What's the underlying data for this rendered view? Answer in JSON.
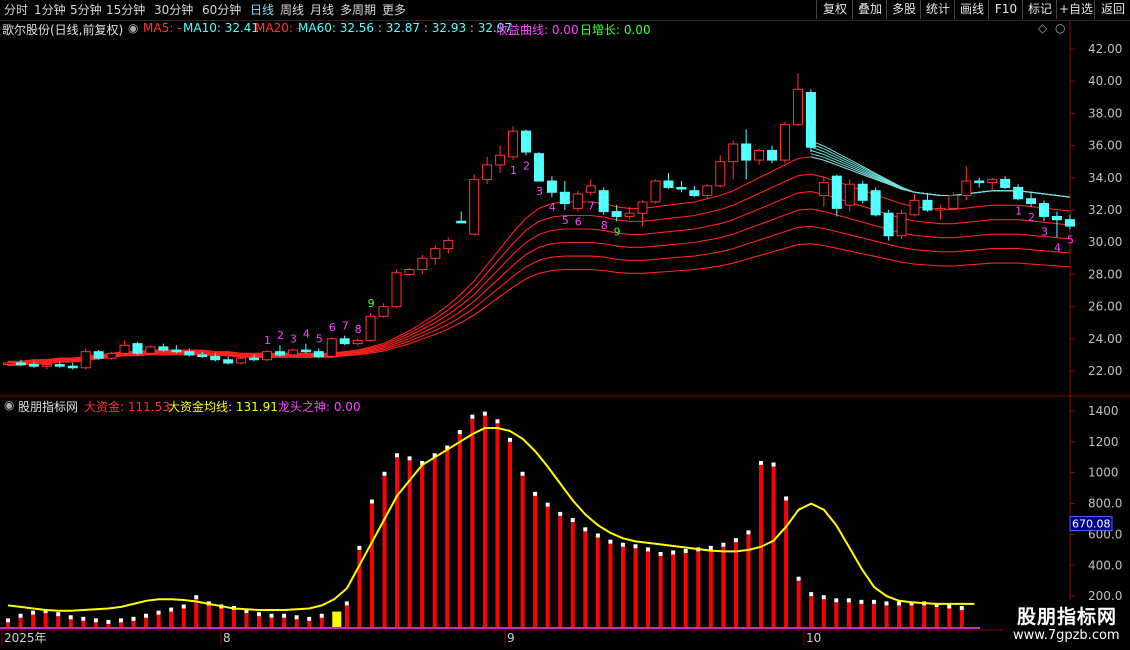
{
  "toolbar": {
    "periods": [
      "分时",
      "1分钟",
      "5分钟",
      "15分钟",
      "30分钟",
      "60分钟",
      "日线",
      "周线",
      "月线",
      "多周期",
      "更多"
    ],
    "active_period": "日线",
    "buttons": [
      "复权",
      "叠加",
      "多股",
      "统计",
      "画线",
      "F10",
      "标记",
      "+自选",
      "返回"
    ]
  },
  "upper_header": {
    "stock": "歌尔股份(日线,前复权)",
    "ma5": "MA5: -",
    "ma10": "MA10: 32.41",
    "ma20": "MA20: -",
    "ma60": "MA60: 32.56 : 32.87 : 32.93 : 32.97",
    "income": "收益曲线: 0.00",
    "daily": "日增长: 0.00"
  },
  "lower_header": {
    "name": "股朋指标网",
    "big_money": "大资金: 111.53",
    "big_money_avg": "大资金均线: 131.91",
    "dragon": "龙头之神: 0.00"
  },
  "upper_axis": [
    "42.00",
    "40.00",
    "38.00",
    "36.00",
    "34.00",
    "32.00",
    "30.00",
    "28.00",
    "26.00",
    "24.00",
    "22.00"
  ],
  "lower_axis": [
    "1400",
    "1200",
    "1000",
    "800.0",
    "600.0",
    "400.0",
    "200.0"
  ],
  "current_value_tag": "670.08",
  "date_labels": [
    "2025年",
    "8",
    "9",
    "10"
  ],
  "seq_labels": {
    "run1": [
      "1",
      "2",
      "3",
      "4",
      "5",
      "6",
      "7",
      "8",
      "9"
    ],
    "run2": [
      "1",
      "2",
      "3",
      "4",
      "5",
      "6",
      "7",
      "8",
      "9"
    ],
    "run3": [
      "1",
      "2",
      "3",
      "4",
      "5"
    ]
  },
  "colors": {
    "up": "#ff3232",
    "down": "#54ffff",
    "ma_band": "#ff2020",
    "ma_band_down": "#6fe0e0",
    "avg_line": "#ffff00",
    "bar": "#ff0000",
    "highlight_bar": "#ffff00",
    "seq_pink": "#ff40ff",
    "seq_green": "#40ff40",
    "axis": "#8b0000"
  },
  "watermark": {
    "title": "股朋指标网",
    "url": "www.7gpzb.com"
  },
  "icons": [
    "collapse-circle-icon",
    "diamond-icon",
    "caret-icon"
  ],
  "chart_data": [
    {
      "type": "candlestick",
      "title": "歌尔股份(日线,前复权)",
      "ylim": [
        21.0,
        43.0
      ],
      "ohlc": [
        [
          22.4,
          22.6,
          22.3,
          22.5
        ],
        [
          22.5,
          22.7,
          22.3,
          22.4
        ],
        [
          22.4,
          22.6,
          22.2,
          22.3
        ],
        [
          22.3,
          22.5,
          22.1,
          22.4
        ],
        [
          22.4,
          22.6,
          22.2,
          22.3
        ],
        [
          22.3,
          22.5,
          22.1,
          22.2
        ],
        [
          22.2,
          23.4,
          22.1,
          23.2
        ],
        [
          23.2,
          23.3,
          22.7,
          22.8
        ],
        [
          22.8,
          23.2,
          22.7,
          23.1
        ],
        [
          23.1,
          23.9,
          23.0,
          23.6
        ],
        [
          23.7,
          23.8,
          23.0,
          23.1
        ],
        [
          23.1,
          23.6,
          23.0,
          23.5
        ],
        [
          23.5,
          23.7,
          23.2,
          23.3
        ],
        [
          23.3,
          23.6,
          23.1,
          23.2
        ],
        [
          23.2,
          23.4,
          22.9,
          23.0
        ],
        [
          23.0,
          23.2,
          22.8,
          22.9
        ],
        [
          22.9,
          23.1,
          22.6,
          22.7
        ],
        [
          22.7,
          22.9,
          22.4,
          22.5
        ],
        [
          22.5,
          22.9,
          22.4,
          22.8
        ],
        [
          22.8,
          23.0,
          22.6,
          22.7
        ],
        [
          22.7,
          23.3,
          22.6,
          23.2
        ],
        [
          23.2,
          23.6,
          22.9,
          23.0
        ],
        [
          23.0,
          23.4,
          22.9,
          23.3
        ],
        [
          23.3,
          23.7,
          23.1,
          23.2
        ],
        [
          23.2,
          23.4,
          22.8,
          22.9
        ],
        [
          22.9,
          24.1,
          22.8,
          24.0
        ],
        [
          24.0,
          24.2,
          23.6,
          23.7
        ],
        [
          23.7,
          24.0,
          23.6,
          23.9
        ],
        [
          23.9,
          25.6,
          23.8,
          25.4
        ],
        [
          25.4,
          26.2,
          25.3,
          26.0
        ],
        [
          26.0,
          28.3,
          25.9,
          28.1
        ],
        [
          28.0,
          28.4,
          27.9,
          28.3
        ],
        [
          28.3,
          29.2,
          28.0,
          29.0
        ],
        [
          29.0,
          29.8,
          28.6,
          29.6
        ],
        [
          29.6,
          30.3,
          29.3,
          30.1
        ],
        [
          31.3,
          31.9,
          31.2,
          31.2
        ],
        [
          30.5,
          34.2,
          30.4,
          33.9
        ],
        [
          33.9,
          35.3,
          33.6,
          34.8
        ],
        [
          34.8,
          36.0,
          34.3,
          35.4
        ],
        [
          35.3,
          37.2,
          35.1,
          36.9
        ],
        [
          36.9,
          37.0,
          35.4,
          35.6
        ],
        [
          35.5,
          35.6,
          33.8,
          33.8
        ],
        [
          33.8,
          34.1,
          32.8,
          33.1
        ],
        [
          33.1,
          33.8,
          32.0,
          32.4
        ],
        [
          32.1,
          33.2,
          31.9,
          33.0
        ],
        [
          33.1,
          33.9,
          32.9,
          33.5
        ],
        [
          33.2,
          33.4,
          31.7,
          31.9
        ],
        [
          31.9,
          32.3,
          31.3,
          31.6
        ],
        [
          31.6,
          32.2,
          31.4,
          31.8
        ],
        [
          31.8,
          32.6,
          31.0,
          32.5
        ],
        [
          32.5,
          33.9,
          32.4,
          33.8
        ],
        [
          33.8,
          34.3,
          33.3,
          33.4
        ],
        [
          33.4,
          33.8,
          33.1,
          33.3
        ],
        [
          33.2,
          33.5,
          32.8,
          32.9
        ],
        [
          32.9,
          33.6,
          32.7,
          33.5
        ],
        [
          33.5,
          35.4,
          33.4,
          35.0
        ],
        [
          35.0,
          36.3,
          33.9,
          36.1
        ],
        [
          36.1,
          37.0,
          33.9,
          35.1
        ],
        [
          35.1,
          35.8,
          34.8,
          35.7
        ],
        [
          35.7,
          36.0,
          34.9,
          35.1
        ],
        [
          35.1,
          37.5,
          34.9,
          37.3
        ],
        [
          37.3,
          40.5,
          37.2,
          39.5
        ],
        [
          39.3,
          39.5,
          35.6,
          35.9
        ],
        [
          32.9,
          34.1,
          32.2,
          33.7
        ],
        [
          34.1,
          34.2,
          31.6,
          32.1
        ],
        [
          32.3,
          33.9,
          31.9,
          33.6
        ],
        [
          33.6,
          33.8,
          32.4,
          32.6
        ],
        [
          33.2,
          33.4,
          31.6,
          31.7
        ],
        [
          31.8,
          32.0,
          30.1,
          30.4
        ],
        [
          30.4,
          32.0,
          30.2,
          31.8
        ],
        [
          31.7,
          33.0,
          31.6,
          32.6
        ],
        [
          32.6,
          33.0,
          31.9,
          32.0
        ],
        [
          32.0,
          32.3,
          31.4,
          32.1
        ],
        [
          32.1,
          33.1,
          32.0,
          32.9
        ],
        [
          32.9,
          34.7,
          32.6,
          33.8
        ],
        [
          33.8,
          34.0,
          33.4,
          33.7
        ],
        [
          33.7,
          34.0,
          33.2,
          33.9
        ],
        [
          33.9,
          34.1,
          33.3,
          33.4
        ],
        [
          33.4,
          33.6,
          32.6,
          32.7
        ],
        [
          32.7,
          33.1,
          32.2,
          32.4
        ],
        [
          32.4,
          32.6,
          31.3,
          31.6
        ],
        [
          31.6,
          31.9,
          30.3,
          31.4
        ],
        [
          31.4,
          31.7,
          30.8,
          31.0
        ]
      ],
      "ma_band_top": [
        22.6,
        22.6,
        22.7,
        22.7,
        22.8,
        22.8,
        22.9,
        23.0,
        23.1,
        23.2,
        23.2,
        23.3,
        23.3,
        23.3,
        23.3,
        23.3,
        23.2,
        23.2,
        23.1,
        23.1,
        23.1,
        23.1,
        23.1,
        23.1,
        23.1,
        23.1,
        23.2,
        23.3,
        23.5,
        23.7,
        24.1,
        24.5,
        25.0,
        25.5,
        26.1,
        26.8,
        27.6,
        28.6,
        29.6,
        30.6,
        31.5,
        32.1,
        32.4,
        32.5,
        32.5,
        32.5,
        32.4,
        32.2,
        32.1,
        32.1,
        32.2,
        32.3,
        32.4,
        32.5,
        32.7,
        32.9,
        33.2,
        33.6,
        34.0,
        34.4,
        34.8,
        35.2,
        35.3,
        35.1,
        34.8,
        34.5,
        34.2,
        33.9,
        33.6,
        33.3,
        33.1,
        33.0,
        32.9,
        32.9,
        33.0,
        33.1,
        33.2,
        33.2,
        33.2,
        33.1,
        33.0,
        32.9,
        32.8
      ],
      "series": [
        {
          "name": "大资金",
          "values": [
            30,
            60,
            80,
            90,
            70,
            50,
            40,
            30,
            20,
            30,
            40,
            60,
            80,
            100,
            120,
            180,
            140,
            120,
            110,
            90,
            70,
            60,
            60,
            50,
            40,
            60,
            100,
            140,
            500,
            800,
            980,
            1100,
            1080,
            1050,
            1100,
            1150,
            1250,
            1350,
            1370,
            1320,
            1200,
            980,
            850,
            780,
            720,
            680,
            620,
            580,
            540,
            520,
            510,
            490,
            460,
            470,
            480,
            490,
            500,
            520,
            550,
            600,
            1050,
            1040,
            820,
            300,
            200,
            180,
            160,
            160,
            150,
            150,
            140,
            140,
            140,
            140,
            130,
            120,
            110
          ]
        },
        {
          "name": "大资金均线",
          "values": [
            140,
            130,
            120,
            110,
            105,
            105,
            110,
            115,
            120,
            130,
            150,
            170,
            180,
            180,
            175,
            165,
            150,
            135,
            120,
            115,
            110,
            110,
            110,
            115,
            120,
            140,
            180,
            250,
            400,
            550,
            700,
            850,
            950,
            1050,
            1100,
            1150,
            1200,
            1250,
            1290,
            1290,
            1270,
            1220,
            1140,
            1040,
            930,
            820,
            730,
            660,
            610,
            575,
            555,
            545,
            535,
            525,
            515,
            505,
            495,
            490,
            490,
            500,
            520,
            560,
            650,
            760,
            800,
            760,
            660,
            520,
            380,
            260,
            200,
            170,
            160,
            155,
            150,
            150,
            150,
            150
          ]
        }
      ]
    }
  ]
}
